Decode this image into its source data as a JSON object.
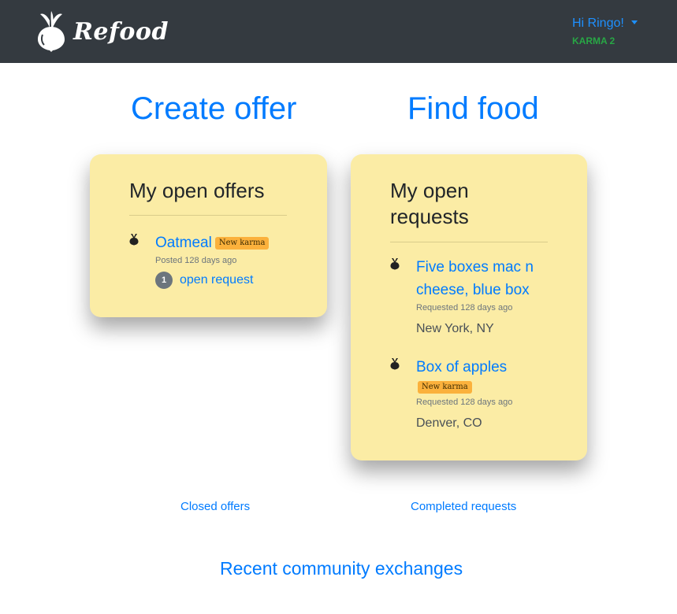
{
  "navbar": {
    "brand_name": "Refood",
    "logo_icon": "beet-icon",
    "greeting": "Hi Ringo!",
    "karma_label": "KARMA 2"
  },
  "actions": {
    "create_offer": "Create offer",
    "find_food": "Find food"
  },
  "offers_card": {
    "title": "My open offers",
    "items": [
      {
        "name": "Oatmeal",
        "badge": "New karma",
        "posted": "Posted 128 days ago",
        "request_count": "1",
        "request_label": "open request"
      }
    ]
  },
  "requests_card": {
    "title": "My open requests",
    "items": [
      {
        "name": "Five boxes mac n cheese, blue box",
        "requested": "Requested 128 days ago",
        "location": "New York, NY"
      },
      {
        "name": "Box of apples",
        "badge": "New karma",
        "requested": "Requested 128 days ago",
        "location": "Denver, CO"
      }
    ]
  },
  "footer": {
    "closed_offers": "Closed offers",
    "completed_requests": "Completed requests",
    "recent_exchanges": "Recent community exchanges"
  },
  "colors": {
    "navbar": "#343a40",
    "link": "#007bff",
    "card": "#fbeca5",
    "badge": "#fbb13c",
    "karma": "#28a745"
  }
}
